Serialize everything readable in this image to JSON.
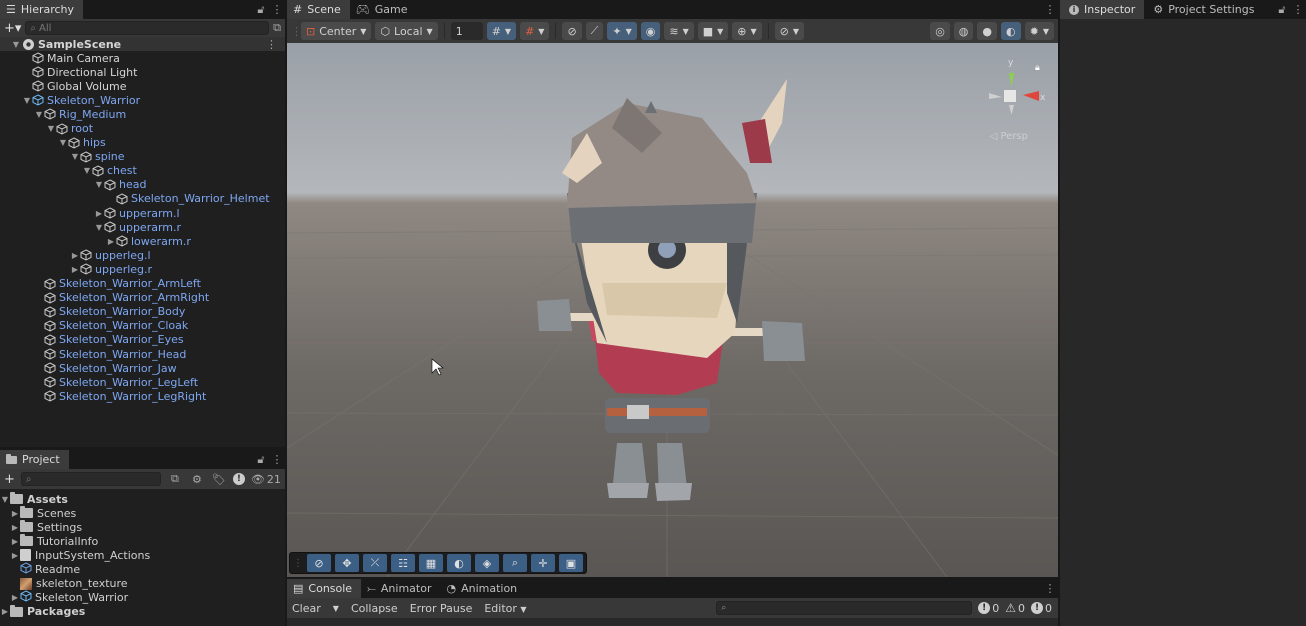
{
  "hierarchy": {
    "tab_label": "Hierarchy",
    "search_placeholder": "All",
    "scene_name": "SampleScene",
    "items": [
      {
        "label": "Main Camera",
        "depth": 1,
        "arrow": "",
        "blue": false
      },
      {
        "label": "Directional Light",
        "depth": 1,
        "arrow": "",
        "blue": false
      },
      {
        "label": "Global Volume",
        "depth": 1,
        "arrow": "",
        "blue": false
      },
      {
        "label": "Skeleton_Warrior",
        "depth": 1,
        "arrow": "down",
        "blue": true,
        "prefab": true
      },
      {
        "label": "Rig_Medium",
        "depth": 2,
        "arrow": "down",
        "blue": true
      },
      {
        "label": "root",
        "depth": 3,
        "arrow": "down",
        "blue": true
      },
      {
        "label": "hips",
        "depth": 4,
        "arrow": "down",
        "blue": true
      },
      {
        "label": "spine",
        "depth": 5,
        "arrow": "down",
        "blue": true
      },
      {
        "label": "chest",
        "depth": 6,
        "arrow": "down",
        "blue": true
      },
      {
        "label": "head",
        "depth": 7,
        "arrow": "down",
        "blue": true
      },
      {
        "label": "Skeleton_Warrior_Helmet",
        "depth": 8,
        "arrow": "",
        "blue": true
      },
      {
        "label": "upperarm.l",
        "depth": 7,
        "arrow": "right",
        "blue": true
      },
      {
        "label": "upperarm.r",
        "depth": 7,
        "arrow": "down",
        "blue": true
      },
      {
        "label": "lowerarm.r",
        "depth": 8,
        "arrow": "right",
        "blue": true
      },
      {
        "label": "upperleg.l",
        "depth": 5,
        "arrow": "right",
        "blue": true
      },
      {
        "label": "upperleg.r",
        "depth": 5,
        "arrow": "right",
        "blue": true
      },
      {
        "label": "Skeleton_Warrior_ArmLeft",
        "depth": 2,
        "arrow": "",
        "blue": true
      },
      {
        "label": "Skeleton_Warrior_ArmRight",
        "depth": 2,
        "arrow": "",
        "blue": true
      },
      {
        "label": "Skeleton_Warrior_Body",
        "depth": 2,
        "arrow": "",
        "blue": true
      },
      {
        "label": "Skeleton_Warrior_Cloak",
        "depth": 2,
        "arrow": "",
        "blue": true
      },
      {
        "label": "Skeleton_Warrior_Eyes",
        "depth": 2,
        "arrow": "",
        "blue": true
      },
      {
        "label": "Skeleton_Warrior_Head",
        "depth": 2,
        "arrow": "",
        "blue": true
      },
      {
        "label": "Skeleton_Warrior_Jaw",
        "depth": 2,
        "arrow": "",
        "blue": true
      },
      {
        "label": "Skeleton_Warrior_LegLeft",
        "depth": 2,
        "arrow": "",
        "blue": true
      },
      {
        "label": "Skeleton_Warrior_LegRight",
        "depth": 2,
        "arrow": "",
        "blue": true
      }
    ]
  },
  "project": {
    "tab_label": "Project",
    "hidden_count": "21",
    "items": [
      {
        "label": "Assets",
        "depth": 0,
        "arrow": "down",
        "icon": "folder",
        "bold": true
      },
      {
        "label": "Scenes",
        "depth": 1,
        "arrow": "right",
        "icon": "folder",
        "bold": false
      },
      {
        "label": "Settings",
        "depth": 1,
        "arrow": "right",
        "icon": "folder",
        "bold": false
      },
      {
        "label": "TutorialInfo",
        "depth": 1,
        "arrow": "right",
        "icon": "folder",
        "bold": false
      },
      {
        "label": "InputSystem_Actions",
        "depth": 1,
        "arrow": "right",
        "icon": "input",
        "bold": false
      },
      {
        "label": "Readme",
        "depth": 1,
        "arrow": "",
        "icon": "readme",
        "bold": false
      },
      {
        "label": "skeleton_texture",
        "depth": 1,
        "arrow": "",
        "icon": "texture",
        "bold": false
      },
      {
        "label": "Skeleton_Warrior",
        "depth": 1,
        "arrow": "right",
        "icon": "prefab",
        "bold": false
      },
      {
        "label": "Packages",
        "depth": 0,
        "arrow": "right",
        "icon": "folder",
        "bold": true
      }
    ]
  },
  "scene": {
    "tabs": [
      {
        "label": "Scene"
      },
      {
        "label": "Game"
      }
    ],
    "pivot_label": "Center",
    "space_label": "Local",
    "grid_size": "1",
    "persp_label": "◁ Persp",
    "gizmo_axes": {
      "y": "y",
      "x": "x"
    }
  },
  "console": {
    "tabs": [
      {
        "label": "Console"
      },
      {
        "label": "Animator"
      },
      {
        "label": "Animation"
      }
    ],
    "clear_label": "Clear",
    "collapse_label": "Collapse",
    "error_pause_label": "Error Pause",
    "editor_label": "Editor",
    "log_count": "0",
    "warning_count": "0",
    "error_count": "0"
  },
  "inspector": {
    "tabs": [
      {
        "label": "Inspector"
      },
      {
        "label": "Project Settings"
      }
    ]
  },
  "colors": {
    "prefab_blue": "#7ea7f2",
    "tool_highlight": "#3c5f86",
    "panel_bg": "#282828"
  }
}
